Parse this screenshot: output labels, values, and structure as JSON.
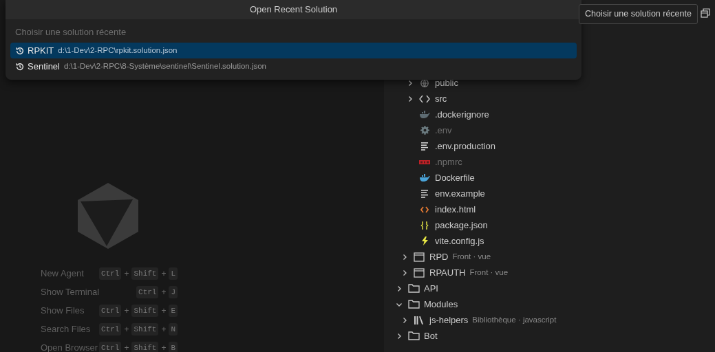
{
  "palette": {
    "title": "Open Recent Solution",
    "search": {
      "placeholder": "Choisir une solution récente"
    },
    "items": [
      {
        "label": "RPKIT",
        "path": "d:\\1-Dev\\2-RPC\\rpkit.solution.json",
        "selected": true
      },
      {
        "label": "Sentinel",
        "path": "d:\\1-Dev\\2-RPC\\8-Système\\sentinel\\Sentinel.solution.json",
        "selected": false
      }
    ]
  },
  "tooltip": "Choisir une solution récente",
  "shortcuts": [
    {
      "label": "New Agent",
      "keys": [
        "Ctrl",
        "+",
        "Shift",
        "+",
        "L"
      ]
    },
    {
      "label": "Show Terminal",
      "keys": [
        "Ctrl",
        "+",
        "J"
      ]
    },
    {
      "label": "Show Files",
      "keys": [
        "Ctrl",
        "+",
        "Shift",
        "+",
        "E"
      ]
    },
    {
      "label": "Search Files",
      "keys": [
        "Ctrl",
        "+",
        "Shift",
        "+",
        "N"
      ]
    },
    {
      "label": "Open Browser",
      "keys": [
        "Ctrl",
        "+",
        "Shift",
        "+",
        "B"
      ]
    }
  ],
  "tree": [
    {
      "children": [
        {
          "children": [
            {
              "label": "public",
              "kind": "web",
              "expanded": false
            },
            {
              "label": "src",
              "kind": "code",
              "expanded": false
            },
            {
              "label": ".dockerignore",
              "kind": "dockerignore",
              "ignored": false
            },
            {
              "label": ".env",
              "kind": "config",
              "ignored": true
            },
            {
              "label": ".env.production",
              "kind": "text",
              "ignored": false
            },
            {
              "label": ".npmrc",
              "kind": "npm",
              "ignored": true
            },
            {
              "label": "Dockerfile",
              "kind": "docker",
              "ignored": false
            },
            {
              "label": "env.example",
              "kind": "text",
              "ignored": false
            },
            {
              "label": "index.html",
              "kind": "html",
              "ignored": false
            },
            {
              "label": "package.json",
              "kind": "json",
              "ignored": false
            },
            {
              "label": "vite.config.js",
              "kind": "vite",
              "ignored": false
            }
          ]
        },
        {
          "label": "RPD",
          "detail": "Front · vue",
          "kind": "project",
          "expanded": false
        },
        {
          "label": "RPAUTH",
          "detail": "Front · vue",
          "kind": "project",
          "expanded": false
        }
      ]
    },
    {
      "label": "API",
      "kind": "folder",
      "expanded": false
    },
    {
      "label": "Modules",
      "kind": "folder",
      "expanded": true,
      "children": [
        {
          "label": "js-helpers",
          "detail": "Bibliothèque · javascript",
          "kind": "library",
          "expanded": false
        }
      ]
    },
    {
      "label": "Bot",
      "kind": "folder",
      "expanded": false
    }
  ]
}
